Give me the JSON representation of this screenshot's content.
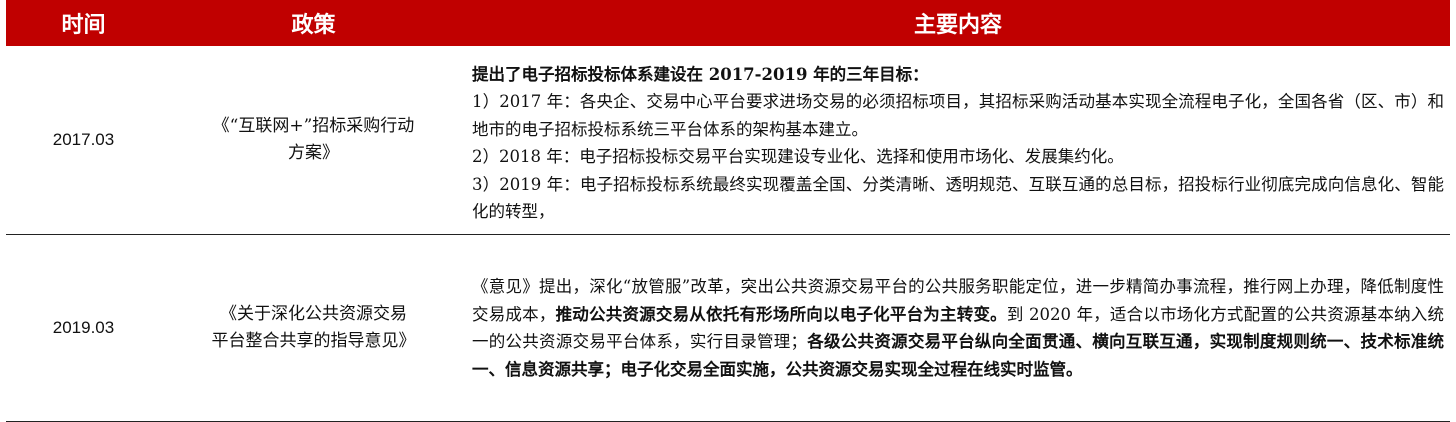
{
  "header": {
    "col_time": "时间",
    "col_policy": "政策",
    "col_content": "主要内容"
  },
  "rows": [
    {
      "date": "2017.03",
      "policy_line1": "《“互联网+”招标采购行动",
      "policy_line2": "方案》",
      "heading": "提出了电子招标投标体系建设在 2017-2019 年的三年目标：",
      "item1": "1）2017 年：各央企、交易中心平台要求进场交易的必须招标项目，其招标采购活动基本实现全流程电子化，全国各省（区、市）和地市的电子招标投标系统三平台体系的架构基本建立。",
      "item2": "2）2018 年：电子招标投标交易平台实现建设专业化、选择和使用市场化、发展集约化。",
      "item3": "3）2019 年：电子招标投标系统最终实现覆盖全国、分类清晰、透明规范、互联互通的总目标，招投标行业彻底完成向信息化、智能化的转型，"
    },
    {
      "date": "2019.03",
      "policy_line1": "《关于深化公共资源交易",
      "policy_line2": "平台整合共享的指导意见》",
      "seg1": "《意见》提出，深化“放管服”改革，突出公共资源交易平台的公共服务职能定位，进一步精简办事流程，推行网上办理，降低制度性交易成本，",
      "seg2_bold": "推动公共资源交易从依托有形场所向以电子化平台为主转变。",
      "seg3": "到 2020 年，适合以市场化方式配置的公共资源基本纳入统一的公共资源交易平台体系，实行目录管理；",
      "seg4_bold": "各级公共资源交易平台纵向全面贯通、横向互联互通，实现制度规则统一、技术标准统一、信息资源共享；电子化交易全面实施，公共资源交易实现全过程在线实时监管。"
    }
  ],
  "colors": {
    "header_bg": "#c00000",
    "header_text": "#ffffff"
  }
}
